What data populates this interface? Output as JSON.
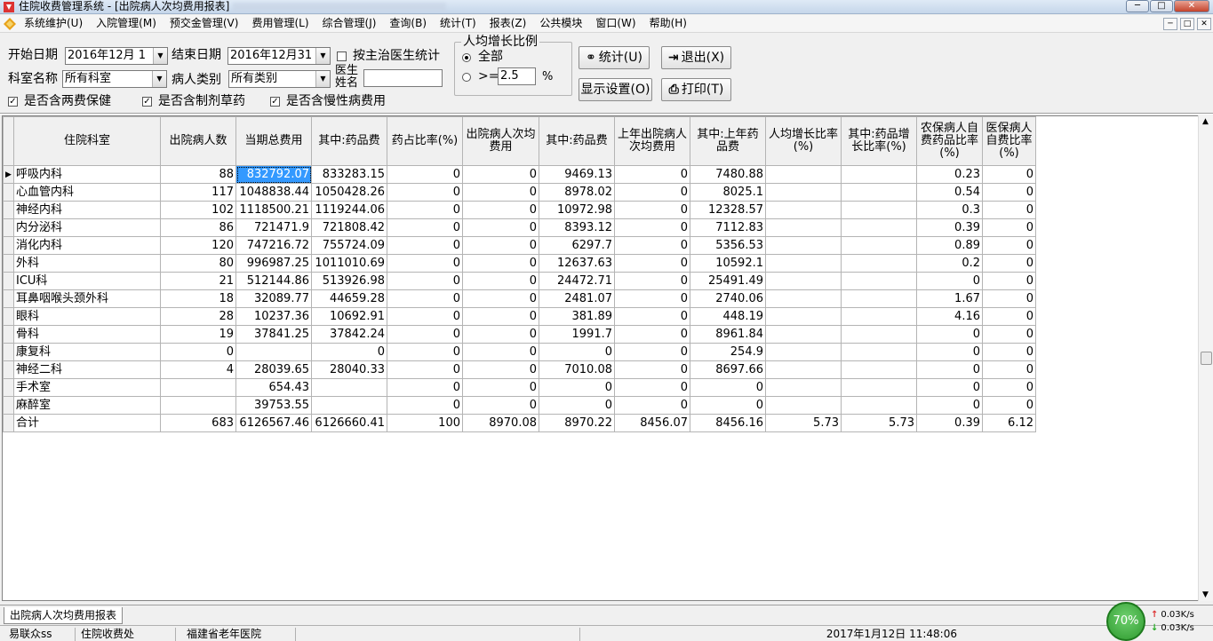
{
  "window": {
    "title": "住院收费管理系统 - [出院病人次均费用报表]",
    "close_label": "✕",
    "min_label": "─",
    "max_label": "□"
  },
  "menu": {
    "items": [
      "系统维护(U)",
      "入院管理(M)",
      "预交金管理(V)",
      "费用管理(L)",
      "综合管理(J)",
      "查询(B)",
      "统计(T)",
      "报表(Z)",
      "公共模块",
      "窗口(W)",
      "帮助(H)"
    ]
  },
  "filters": {
    "start_date_label": "开始日期",
    "start_date_value": "2016年12月 1",
    "end_date_label": "结束日期",
    "end_date_value": "2016年12月31",
    "by_doctor_label": "按主治医生统计",
    "dept_label": "科室名称",
    "dept_value": "所有科室",
    "patient_type_label": "病人类别",
    "patient_type_value": "所有类别",
    "doctor_name_label_1": "医生",
    "doctor_name_label_2": "姓名",
    "doctor_name_value": "",
    "incl_two_fee_label": "是否含两费保健",
    "incl_herbal_label": "是否含制剂草药",
    "incl_chronic_label": "是否含慢性病费用",
    "growth_group_title": "人均增长比例",
    "growth_all_label": "全部",
    "growth_ge_label": ">=",
    "growth_ge_value": "2.5",
    "growth_unit": "%"
  },
  "buttons": {
    "stat_label": "统计(U)",
    "exit_label": "退出(X)",
    "display_settings_label": "显示设置(O)",
    "print_label": "打印(T)"
  },
  "table": {
    "columns": [
      "住院科室",
      "出院病人数",
      "当期总费用",
      "其中:药品费",
      "药占比率(%)",
      "出院病人次均费用",
      "其中:药品费",
      "上年出院病人次均费用",
      "其中:上年药品费",
      "人均增长比率(%)",
      "其中:药品增长比率(%)",
      "农保病人自费药品比率(%)",
      "医保病人自费比率(%)"
    ],
    "rows": [
      [
        "呼吸内科",
        "88",
        "832792.07",
        "833283.15",
        "0",
        "0",
        "9469.13",
        "0",
        "7480.88",
        "",
        "",
        "0.23",
        "0"
      ],
      [
        "心血管内科",
        "117",
        "1048838.44",
        "1050428.26",
        "0",
        "0",
        "8978.02",
        "0",
        "8025.1",
        "",
        "",
        "0.54",
        "0"
      ],
      [
        "神经内科",
        "102",
        "1118500.21",
        "1119244.06",
        "0",
        "0",
        "10972.98",
        "0",
        "12328.57",
        "",
        "",
        "0.3",
        "0"
      ],
      [
        "内分泌科",
        "86",
        "721471.9",
        "721808.42",
        "0",
        "0",
        "8393.12",
        "0",
        "7112.83",
        "",
        "",
        "0.39",
        "0"
      ],
      [
        "消化内科",
        "120",
        "747216.72",
        "755724.09",
        "0",
        "0",
        "6297.7",
        "0",
        "5356.53",
        "",
        "",
        "0.89",
        "0"
      ],
      [
        "外科",
        "80",
        "996987.25",
        "1011010.69",
        "0",
        "0",
        "12637.63",
        "0",
        "10592.1",
        "",
        "",
        "0.2",
        "0"
      ],
      [
        "ICU科",
        "21",
        "512144.86",
        "513926.98",
        "0",
        "0",
        "24472.71",
        "0",
        "25491.49",
        "",
        "",
        "0",
        "0"
      ],
      [
        "耳鼻咽喉头颈外科",
        "18",
        "32089.77",
        "44659.28",
        "0",
        "0",
        "2481.07",
        "0",
        "2740.06",
        "",
        "",
        "1.67",
        "0"
      ],
      [
        "眼科",
        "28",
        "10237.36",
        "10692.91",
        "0",
        "0",
        "381.89",
        "0",
        "448.19",
        "",
        "",
        "4.16",
        "0"
      ],
      [
        "骨科",
        "19",
        "37841.25",
        "37842.24",
        "0",
        "0",
        "1991.7",
        "0",
        "8961.84",
        "",
        "",
        "0",
        "0"
      ],
      [
        "康复科",
        "0",
        "",
        "0",
        "0",
        "0",
        "0",
        "0",
        "254.9",
        "",
        "",
        "0",
        "0"
      ],
      [
        "神经二科",
        "4",
        "28039.65",
        "28040.33",
        "0",
        "0",
        "7010.08",
        "0",
        "8697.66",
        "",
        "",
        "0",
        "0"
      ],
      [
        "手术室",
        "",
        "654.43",
        "",
        "0",
        "0",
        "0",
        "0",
        "0",
        "",
        "",
        "0",
        "0"
      ],
      [
        "麻醉室",
        "",
        "39753.55",
        "",
        "0",
        "0",
        "0",
        "0",
        "0",
        "",
        "",
        "0",
        "0"
      ],
      [
        "合计",
        "683",
        "6126567.46",
        "6126660.41",
        "100",
        "8970.08",
        "8970.22",
        "8456.07",
        "8456.16",
        "5.73",
        "5.73",
        "0.39",
        "6.12"
      ]
    ]
  },
  "tabs": [
    "出院病人次均费用报表"
  ],
  "status": {
    "user": "易联众ss",
    "module": "住院收费处",
    "hospital": "福建省老年医院",
    "datetime": "2017年1月12日 11:48:06"
  },
  "network": {
    "percent": "70%",
    "up": "0.03K/s",
    "down": "0.03K/s"
  }
}
